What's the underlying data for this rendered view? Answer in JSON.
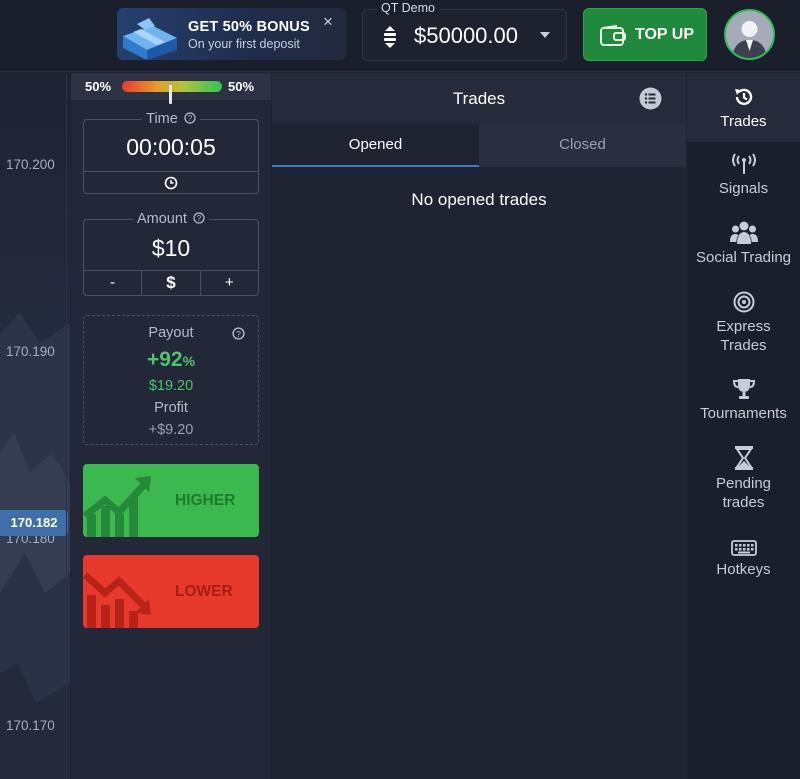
{
  "header": {
    "bonus": {
      "title": "GET 50% BONUS",
      "subtitle": "On your first deposit",
      "close": "×"
    },
    "account": {
      "name": "QT Demo",
      "balance": "$50000.00"
    },
    "topup_label": "TOP UP"
  },
  "chart": {
    "prices": [
      "170.200",
      "170.190",
      "170.180",
      "170.170"
    ],
    "current_price": "170.182"
  },
  "trade_panel": {
    "sentiment": {
      "left_pct": "50%",
      "right_pct": "50%",
      "buy_fraction": 0.5
    },
    "time": {
      "label": "Time",
      "value": "00:00:05"
    },
    "amount": {
      "label": "Amount",
      "value": "$10",
      "minus": "-",
      "currency": "$",
      "plus": "+"
    },
    "payout": {
      "label": "Payout",
      "percent": "+92",
      "percent_sign": "%",
      "amount": "$19.20",
      "profit_label": "Profit",
      "profit_value": "+$9.20"
    },
    "higher_label": "HIGHER",
    "lower_label": "LOWER",
    "colors": {
      "higher": "#3bb84e",
      "lower": "#e8392d",
      "accent": "#3d7ccb"
    }
  },
  "trades": {
    "title": "Trades",
    "tabs": [
      {
        "label": "Opened"
      },
      {
        "label": "Closed"
      }
    ],
    "empty_message": "No opened trades"
  },
  "sidebar": {
    "items": [
      {
        "label": "Trades",
        "icon": "history-icon"
      },
      {
        "label": "Signals",
        "icon": "antenna-icon"
      },
      {
        "label": "Social Trading",
        "icon": "users-icon"
      },
      {
        "label_line1": "Express",
        "label_line2": "Trades",
        "icon": "target-icon"
      },
      {
        "label": "Tournaments",
        "icon": "trophy-icon"
      },
      {
        "label_line1": "Pending",
        "label_line2": "trades",
        "icon": "hourglass-icon"
      },
      {
        "label": "Hotkeys",
        "icon": "keyboard-icon"
      }
    ]
  }
}
